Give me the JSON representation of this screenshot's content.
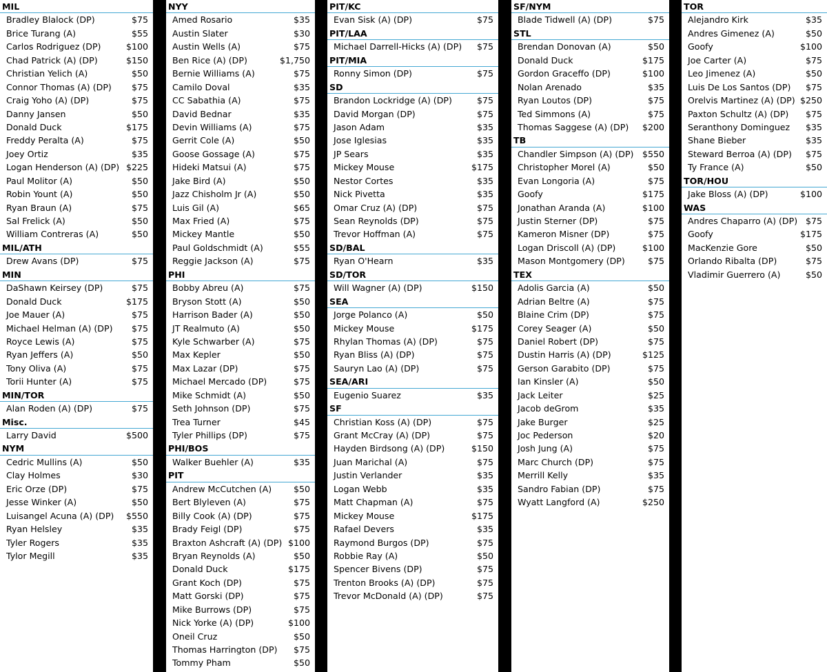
{
  "columns": [
    {
      "rows": [
        {
          "team": "MIL"
        },
        {
          "name": "Bradley Blalock (DP)",
          "price": "$75"
        },
        {
          "name": "Brice Turang (A)",
          "price": "$55"
        },
        {
          "name": "Carlos Rodriguez (DP)",
          "price": "$100"
        },
        {
          "name": "Chad Patrick (A) (DP)",
          "price": "$150"
        },
        {
          "name": "Christian Yelich (A)",
          "price": "$50"
        },
        {
          "name": "Connor Thomas (A) (DP)",
          "price": "$75"
        },
        {
          "name": "Craig Yoho (A) (DP)",
          "price": "$75"
        },
        {
          "name": "Danny Jansen",
          "price": "$50"
        },
        {
          "name": "Donald Duck",
          "price": "$175"
        },
        {
          "name": "Freddy Peralta (A)",
          "price": "$75"
        },
        {
          "name": "Joey Ortiz",
          "price": "$35"
        },
        {
          "name": "Logan Henderson (A) (DP)",
          "price": "$225"
        },
        {
          "name": "Paul Molitor (A)",
          "price": "$50"
        },
        {
          "name": "Robin Yount (A)",
          "price": "$50"
        },
        {
          "name": "Ryan Braun (A)",
          "price": "$75"
        },
        {
          "name": "Sal Frelick (A)",
          "price": "$50"
        },
        {
          "name": "William Contreras (A)",
          "price": "$50"
        },
        {
          "team": "MIL/ATH"
        },
        {
          "name": "Drew Avans (DP)",
          "price": "$75"
        },
        {
          "team": "MIN"
        },
        {
          "name": "DaShawn Keirsey (DP)",
          "price": "$75"
        },
        {
          "name": "Donald Duck",
          "price": "$175"
        },
        {
          "name": "Joe Mauer (A)",
          "price": "$75"
        },
        {
          "name": "Michael Helman (A) (DP)",
          "price": "$75"
        },
        {
          "name": "Royce Lewis (A)",
          "price": "$75"
        },
        {
          "name": "Ryan Jeffers (A)",
          "price": "$50"
        },
        {
          "name": "Tony Oliva (A)",
          "price": "$75"
        },
        {
          "name": "Torii Hunter (A)",
          "price": "$75"
        },
        {
          "team": "MIN/TOR"
        },
        {
          "name": "Alan Roden (A) (DP)",
          "price": "$75"
        },
        {
          "team": "Misc."
        },
        {
          "name": "Larry David",
          "price": "$500"
        },
        {
          "team": "NYM"
        },
        {
          "name": "Cedric Mullins (A)",
          "price": "$50"
        },
        {
          "name": "Clay Holmes",
          "price": "$30"
        },
        {
          "name": "Eric Orze (DP)",
          "price": "$75"
        },
        {
          "name": "Jesse Winker (A)",
          "price": "$50"
        },
        {
          "name": "Luisangel Acuna (A) (DP)",
          "price": "$550"
        },
        {
          "name": "Ryan Helsley",
          "price": "$35"
        },
        {
          "name": "Tyler Rogers",
          "price": "$35"
        },
        {
          "name": "Tylor Megill",
          "price": "$35"
        }
      ]
    },
    {
      "rows": [
        {
          "team": "NYY"
        },
        {
          "name": "Amed Rosario",
          "price": "$35"
        },
        {
          "name": "Austin Slater",
          "price": "$30"
        },
        {
          "name": "Austin Wells (A)",
          "price": "$75"
        },
        {
          "name": "Ben Rice (A) (DP)",
          "price": "$1,750"
        },
        {
          "name": "Bernie Williams (A)",
          "price": "$75"
        },
        {
          "name": "Camilo Doval",
          "price": "$35"
        },
        {
          "name": "CC Sabathia (A)",
          "price": "$75"
        },
        {
          "name": "David Bednar",
          "price": "$35"
        },
        {
          "name": "Devin Williams (A)",
          "price": "$75"
        },
        {
          "name": "Gerrit Cole (A)",
          "price": "$50"
        },
        {
          "name": "Goose Gossage (A)",
          "price": "$75"
        },
        {
          "name": "Hideki Matsui (A)",
          "price": "$75"
        },
        {
          "name": "Jake Bird (A)",
          "price": "$50"
        },
        {
          "name": "Jazz Chisholm Jr (A)",
          "price": "$50"
        },
        {
          "name": "Luis Gil (A)",
          "price": "$65"
        },
        {
          "name": "Max Fried (A)",
          "price": "$75"
        },
        {
          "name": "Mickey Mantle",
          "price": "$50"
        },
        {
          "name": "Paul Goldschmidt (A)",
          "price": "$55"
        },
        {
          "name": "Reggie Jackson (A)",
          "price": "$75"
        },
        {
          "team": "PHI"
        },
        {
          "name": "Bobby Abreu (A)",
          "price": "$75"
        },
        {
          "name": "Bryson Stott (A)",
          "price": "$50"
        },
        {
          "name": "Harrison Bader (A)",
          "price": "$50"
        },
        {
          "name": "JT Realmuto (A)",
          "price": "$50"
        },
        {
          "name": "Kyle Schwarber (A)",
          "price": "$75"
        },
        {
          "name": "Max Kepler",
          "price": "$50"
        },
        {
          "name": "Max Lazar (DP)",
          "price": "$75"
        },
        {
          "name": "Michael Mercado (DP)",
          "price": "$75"
        },
        {
          "name": "Mike Schmidt (A)",
          "price": "$50"
        },
        {
          "name": "Seth Johnson (DP)",
          "price": "$75"
        },
        {
          "name": "Trea Turner",
          "price": "$45"
        },
        {
          "name": "Tyler Phillips (DP)",
          "price": "$75"
        },
        {
          "team": "PHI/BOS"
        },
        {
          "name": "Walker Buehler (A)",
          "price": "$35"
        },
        {
          "team": "PIT"
        },
        {
          "name": "Andrew McCutchen (A)",
          "price": "$50"
        },
        {
          "name": "Bert Blyleven (A)",
          "price": "$75"
        },
        {
          "name": "Billy Cook (A) (DP)",
          "price": "$75"
        },
        {
          "name": "Brady Feigl (DP)",
          "price": "$75"
        },
        {
          "name": "Braxton Ashcraft (A) (DP)",
          "price": "$100"
        },
        {
          "name": "Bryan Reynolds (A)",
          "price": "$50"
        },
        {
          "name": "Donald Duck",
          "price": "$175"
        },
        {
          "name": "Grant Koch (DP)",
          "price": "$75"
        },
        {
          "name": "Matt Gorski (DP)",
          "price": "$75"
        },
        {
          "name": "Mike Burrows (DP)",
          "price": "$75"
        },
        {
          "name": "Nick Yorke (A) (DP)",
          "price": "$100"
        },
        {
          "name": "Oneil Cruz",
          "price": "$50"
        },
        {
          "name": "Thomas Harrington (DP)",
          "price": "$75"
        },
        {
          "name": "Tommy Pham",
          "price": "$50"
        }
      ]
    },
    {
      "rows": [
        {
          "team": "PIT/KC"
        },
        {
          "name": "Evan Sisk (A) (DP)",
          "price": "$75"
        },
        {
          "team": "PIT/LAA"
        },
        {
          "name": "Michael Darrell-Hicks (A) (DP)",
          "price": "$75"
        },
        {
          "team": "PIT/MIA"
        },
        {
          "name": "Ronny Simon (DP)",
          "price": "$75"
        },
        {
          "team": "SD"
        },
        {
          "name": "Brandon Lockridge (A) (DP)",
          "price": "$75"
        },
        {
          "name": "David Morgan (DP)",
          "price": "$75"
        },
        {
          "name": "Jason Adam",
          "price": "$35"
        },
        {
          "name": "Jose Iglesias",
          "price": "$35"
        },
        {
          "name": "JP Sears",
          "price": "$35"
        },
        {
          "name": "Mickey Mouse",
          "price": "$175"
        },
        {
          "name": "Nestor Cortes",
          "price": "$35"
        },
        {
          "name": "Nick Pivetta",
          "price": "$35"
        },
        {
          "name": "Omar Cruz (A) (DP)",
          "price": "$75"
        },
        {
          "name": "Sean Reynolds (DP)",
          "price": "$75"
        },
        {
          "name": "Trevor Hoffman (A)",
          "price": "$75"
        },
        {
          "team": "SD/BAL"
        },
        {
          "name": "Ryan O'Hearn",
          "price": "$35"
        },
        {
          "team": "SD/TOR"
        },
        {
          "name": "Will Wagner (A) (DP)",
          "price": "$150"
        },
        {
          "team": "SEA"
        },
        {
          "name": "Jorge Polanco (A)",
          "price": "$50"
        },
        {
          "name": "Mickey Mouse",
          "price": "$175"
        },
        {
          "name": "Rhylan Thomas (A) (DP)",
          "price": "$75"
        },
        {
          "name": "Ryan Bliss (A) (DP)",
          "price": "$75"
        },
        {
          "name": "Sauryn Lao (A) (DP)",
          "price": "$75"
        },
        {
          "team": "SEA/ARI"
        },
        {
          "name": "Eugenio Suarez",
          "price": "$35"
        },
        {
          "team": "SF"
        },
        {
          "name": "Christian Koss (A) (DP)",
          "price": "$75"
        },
        {
          "name": "Grant McCray (A) (DP)",
          "price": "$75"
        },
        {
          "name": "Hayden Birdsong (A) (DP)",
          "price": "$150"
        },
        {
          "name": "Juan Marichal (A)",
          "price": "$75"
        },
        {
          "name": "Justin Verlander",
          "price": "$35"
        },
        {
          "name": "Logan Webb",
          "price": "$35"
        },
        {
          "name": "Matt Chapman (A)",
          "price": "$75"
        },
        {
          "name": "Mickey Mouse",
          "price": "$175"
        },
        {
          "name": "Rafael Devers",
          "price": "$35"
        },
        {
          "name": "Raymond Burgos (DP)",
          "price": "$75"
        },
        {
          "name": "Robbie Ray (A)",
          "price": "$50"
        },
        {
          "name": "Spencer Bivens (DP)",
          "price": "$75"
        },
        {
          "name": "Trenton Brooks (A) (DP)",
          "price": "$75"
        },
        {
          "name": "Trevor McDonald (A) (DP)",
          "price": "$75"
        }
      ]
    },
    {
      "rows": [
        {
          "team": "SF/NYM"
        },
        {
          "name": "Blade Tidwell (A) (DP)",
          "price": "$75"
        },
        {
          "team": "STL"
        },
        {
          "name": "Brendan Donovan (A)",
          "price": "$50"
        },
        {
          "name": "Donald Duck",
          "price": "$175"
        },
        {
          "name": "Gordon Graceffo (DP)",
          "price": "$100"
        },
        {
          "name": "Nolan Arenado",
          "price": "$35"
        },
        {
          "name": "Ryan Loutos (DP)",
          "price": "$75"
        },
        {
          "name": "Ted Simmons (A)",
          "price": "$75"
        },
        {
          "name": "Thomas Saggese (A) (DP)",
          "price": "$200"
        },
        {
          "team": "TB"
        },
        {
          "name": "Chandler Simpson (A) (DP)",
          "price": "$550"
        },
        {
          "name": "Christopher Morel (A)",
          "price": "$50"
        },
        {
          "name": "Evan Longoria (A)",
          "price": "$75"
        },
        {
          "name": "Goofy",
          "price": "$175"
        },
        {
          "name": "Jonathan Aranda (A)",
          "price": "$100"
        },
        {
          "name": "Justin Sterner (DP)",
          "price": "$75"
        },
        {
          "name": "Kameron Misner (DP)",
          "price": "$75"
        },
        {
          "name": "Logan Driscoll (A) (DP)",
          "price": "$100"
        },
        {
          "name": "Mason Montgomery (DP)",
          "price": "$75"
        },
        {
          "team": "TEX"
        },
        {
          "name": "Adolis Garcia (A)",
          "price": "$50"
        },
        {
          "name": "Adrian Beltre (A)",
          "price": "$75"
        },
        {
          "name": "Blaine Crim (DP)",
          "price": "$75"
        },
        {
          "name": "Corey Seager (A)",
          "price": "$50"
        },
        {
          "name": "Daniel Robert (DP)",
          "price": "$75"
        },
        {
          "name": "Dustin Harris (A) (DP)",
          "price": "$125"
        },
        {
          "name": "Gerson Garabito (DP)",
          "price": "$75"
        },
        {
          "name": "Ian Kinsler (A)",
          "price": "$50"
        },
        {
          "name": "Jack Leiter",
          "price": "$25"
        },
        {
          "name": "Jacob deGrom",
          "price": "$35"
        },
        {
          "name": "Jake Burger",
          "price": "$25"
        },
        {
          "name": "Joc Pederson",
          "price": "$20"
        },
        {
          "name": "Josh Jung (A)",
          "price": "$75"
        },
        {
          "name": "Marc Church (DP)",
          "price": "$75"
        },
        {
          "name": "Merrill Kelly",
          "price": "$35"
        },
        {
          "name": "Sandro Fabian (DP)",
          "price": "$75"
        },
        {
          "name": "Wyatt Langford (A)",
          "price": "$250"
        }
      ]
    },
    {
      "rows": [
        {
          "team": "TOR"
        },
        {
          "name": "Alejandro Kirk",
          "price": "$35"
        },
        {
          "name": "Andres Gimenez (A)",
          "price": "$50"
        },
        {
          "name": "Goofy",
          "price": "$100"
        },
        {
          "name": "Joe Carter (A)",
          "price": "$75"
        },
        {
          "name": "Leo Jimenez (A)",
          "price": "$50"
        },
        {
          "name": "Luis De Los Santos (DP)",
          "price": "$75"
        },
        {
          "name": "Orelvis Martinez (A) (DP)",
          "price": "$250"
        },
        {
          "name": "Paxton Schultz (A) (DP)",
          "price": "$75"
        },
        {
          "name": "Seranthony Dominguez",
          "price": "$35"
        },
        {
          "name": "Shane Bieber",
          "price": "$35"
        },
        {
          "name": "Steward Berroa (A) (DP)",
          "price": "$75"
        },
        {
          "name": "Ty France (A)",
          "price": "$50"
        },
        {
          "team": "TOR/HOU"
        },
        {
          "name": "Jake Bloss (A) (DP)",
          "price": "$100"
        },
        {
          "team": "WAS"
        },
        {
          "name": "Andres Chaparro (A) (DP)",
          "price": "$75"
        },
        {
          "name": "Goofy",
          "price": "$175"
        },
        {
          "name": "MacKenzie Gore",
          "price": "$50"
        },
        {
          "name": "Orlando Ribalta (DP)",
          "price": "$75"
        },
        {
          "name": "Vladimir Guerrero (A)",
          "price": "$50"
        }
      ]
    }
  ]
}
